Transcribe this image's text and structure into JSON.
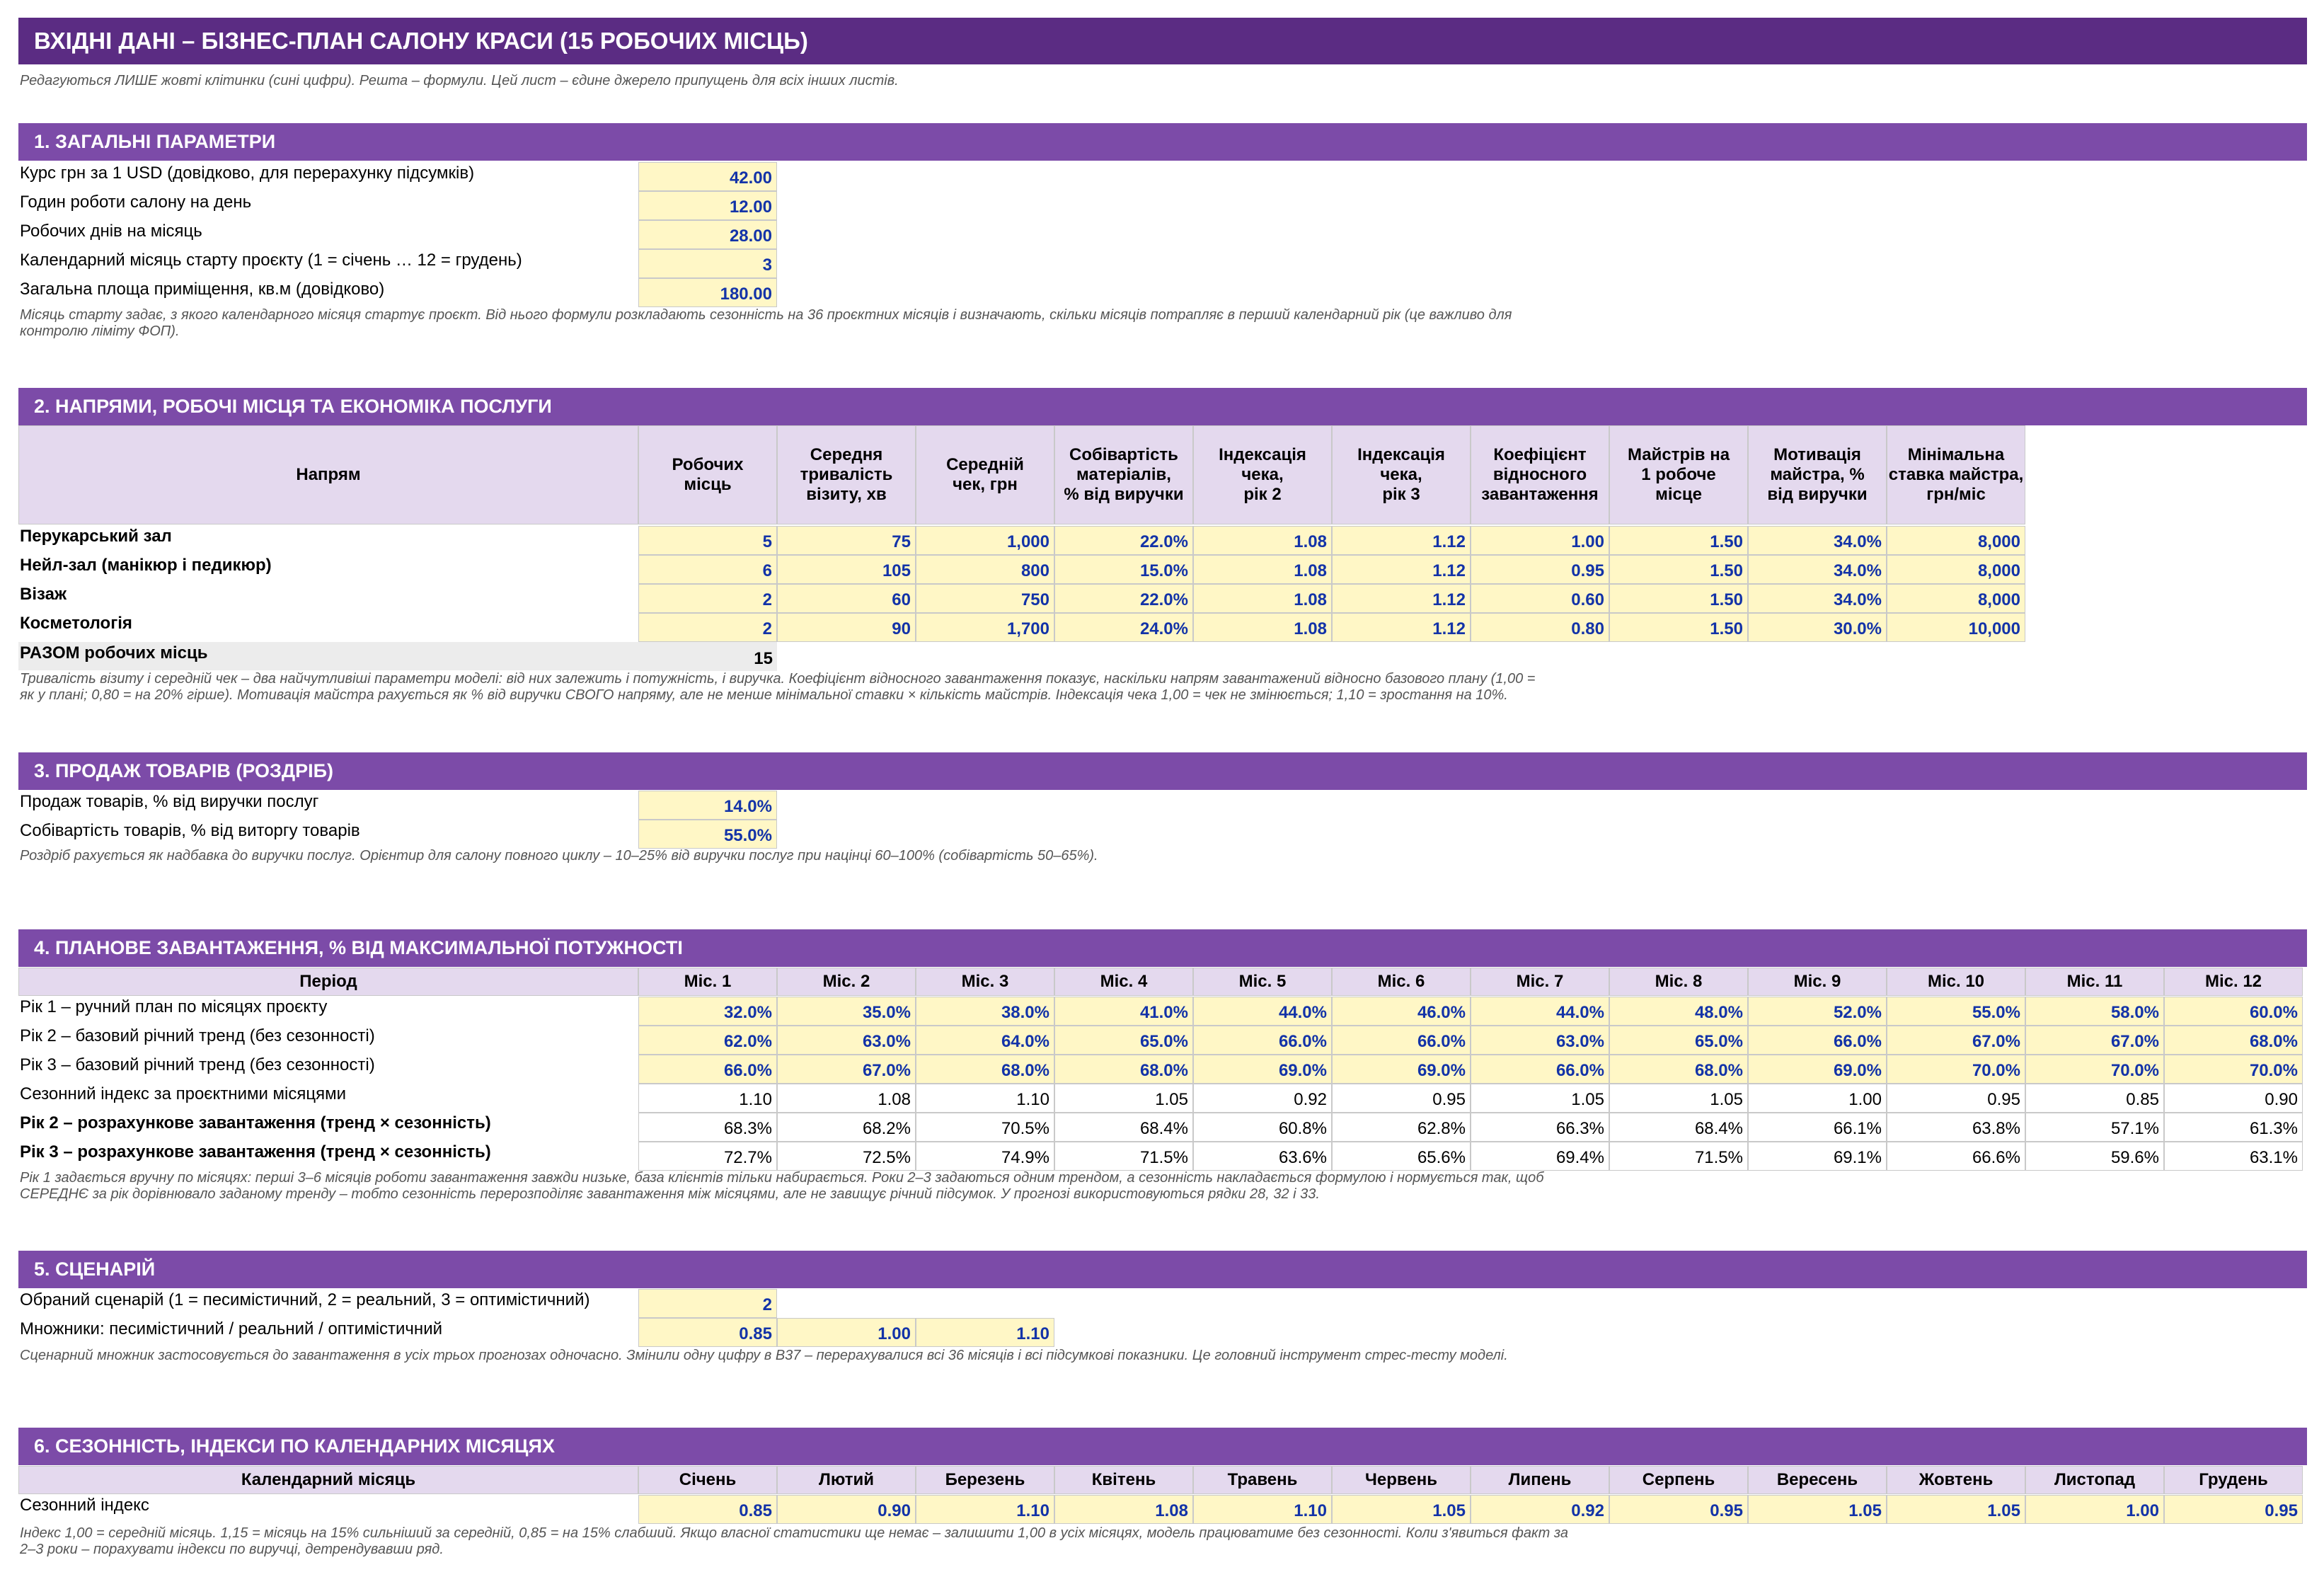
{
  "title": "ВХІДНІ ДАНІ – БІЗНЕС-ПЛАН САЛОНУ КРАСИ (15 РОБОЧИХ МІСЦЬ)",
  "subtitle": "Редагуються ЛИШЕ жовті клітинки (сині цифри). Решта – формули. Цей лист – єдине джерело припущень для всіх інших листів.",
  "s1": {
    "header": "1. ЗАГАЛЬНІ ПАРАМЕТРИ",
    "rows": [
      {
        "label": "Курс грн за 1 USD (довідково, для перерахунку підсумків)",
        "value": "42.00"
      },
      {
        "label": "Годин роботи салону на день",
        "value": "12.00"
      },
      {
        "label": "Робочих днів на місяць",
        "value": "28.00"
      },
      {
        "label": "Календарний місяць старту проєкту (1 = січень … 12 = грудень)",
        "value": "3"
      },
      {
        "label": "Загальна площа приміщення, кв.м (довідково)",
        "value": "180.00"
      }
    ],
    "note1": "Місяць старту задає, з якого календарного місяця стартує проєкт. Від нього формули розкладають сезонність на 36 проєктних місяців і визначають, скільки місяців потрапляє в перший календарний рік (це важливо для",
    "note2": "контролю ліміту ФОП)."
  },
  "s2": {
    "header": "2. НАПРЯМИ, РОБОЧІ МІСЦЯ ТА ЕКОНОМІКА ПОСЛУГИ",
    "col0": "Напрям",
    "cols": [
      [
        "Робочих",
        "місць"
      ],
      [
        "Середня",
        "тривалість",
        "візиту, хв"
      ],
      [
        "Середній",
        "чек, грн"
      ],
      [
        "Собівартість",
        "матеріалів,",
        "% від виручки"
      ],
      [
        "Індексація",
        "чека,",
        "рік 2"
      ],
      [
        "Індексація",
        "чека,",
        "рік 3"
      ],
      [
        "Коефіцієнт",
        "відносного",
        "завантаження"
      ],
      [
        "Майстрів на",
        "1 робоче",
        "місце"
      ],
      [
        "Мотивація",
        "майстра, %",
        "від виручки"
      ],
      [
        "Мінімальна",
        "ставка майстра,",
        "грн/міс"
      ]
    ],
    "rows": [
      {
        "label": "Перукарський зал",
        "v": [
          "5",
          "75",
          "1,000",
          "22.0%",
          "1.08",
          "1.12",
          "1.00",
          "1.50",
          "34.0%",
          "8,000"
        ]
      },
      {
        "label": "Нейл-зал (манікюр і педикюр)",
        "v": [
          "6",
          "105",
          "800",
          "15.0%",
          "1.08",
          "1.12",
          "0.95",
          "1.50",
          "34.0%",
          "8,000"
        ]
      },
      {
        "label": "Візаж",
        "v": [
          "2",
          "60",
          "750",
          "22.0%",
          "1.08",
          "1.12",
          "0.60",
          "1.50",
          "34.0%",
          "8,000"
        ]
      },
      {
        "label": "Косметологія",
        "v": [
          "2",
          "90",
          "1,700",
          "24.0%",
          "1.08",
          "1.12",
          "0.80",
          "1.50",
          "30.0%",
          "10,000"
        ]
      }
    ],
    "total_label": "РАЗОМ робочих місць",
    "total_value": "15",
    "note1": "Тривалість візиту і середній чек – два найчутливіші параметри моделі: від них залежить і потужність, і виручка. Коефіцієнт відносного завантаження показує, наскільки напрям завантажений відносно базового плану (1,00 =",
    "note2": "як у плані; 0,80 = на 20% гірше). Мотивація майстра рахується як % від виручки СВОГО напряму, але не менше мінімальної ставки × кількість майстрів. Індексація чека 1,00 = чек не змінюється; 1,10 = зростання на 10%."
  },
  "s3": {
    "header": "3. ПРОДАЖ ТОВАРІВ (РОЗДРІБ)",
    "rows": [
      {
        "label": "Продаж товарів, % від виручки послуг",
        "value": "14.0%"
      },
      {
        "label": "Собівартість товарів, % від виторгу товарів",
        "value": "55.0%"
      }
    ],
    "note1": "Роздріб рахується як надбавка до виручки послуг. Орієнтир для салону повного циклу – 10–25% від виручки послуг при націнці 60–100% (собівартість 50–65%)."
  },
  "s4": {
    "header": "4. ПЛАНОВЕ ЗАВАНТАЖЕННЯ, % ВІД МАКСИМАЛЬНОЇ ПОТУЖНОСТІ",
    "col0": "Період",
    "months": [
      "Міс. 1",
      "Міс. 2",
      "Міс. 3",
      "Міс. 4",
      "Міс. 5",
      "Міс. 6",
      "Міс. 7",
      "Міс. 8",
      "Міс. 9",
      "Міс. 10",
      "Міс. 11",
      "Міс. 12"
    ],
    "rows": [
      {
        "label": "Рік 1 – ручний план по місяцях проєкту",
        "v": [
          "32.0%",
          "35.0%",
          "38.0%",
          "41.0%",
          "44.0%",
          "46.0%",
          "44.0%",
          "48.0%",
          "52.0%",
          "55.0%",
          "58.0%",
          "60.0%"
        ]
      },
      {
        "label": "Рік 2 – базовий річний тренд (без сезонності)",
        "v": [
          "62.0%",
          "63.0%",
          "64.0%",
          "65.0%",
          "66.0%",
          "66.0%",
          "63.0%",
          "65.0%",
          "66.0%",
          "67.0%",
          "67.0%",
          "68.0%"
        ]
      },
      {
        "label": "Рік 3 – базовий річний тренд (без сезонності)",
        "v": [
          "66.0%",
          "67.0%",
          "68.0%",
          "68.0%",
          "69.0%",
          "69.0%",
          "66.0%",
          "68.0%",
          "69.0%",
          "70.0%",
          "70.0%",
          "70.0%"
        ]
      },
      {
        "label": "Сезонний індекс за проєктними місяцями",
        "v": [
          "1.10",
          "1.08",
          "1.10",
          "1.05",
          "0.92",
          "0.95",
          "1.05",
          "1.05",
          "1.00",
          "0.95",
          "0.85",
          "0.90"
        ]
      },
      {
        "label": "Рік 2 – розрахункове завантаження (тренд × сезонність)",
        "v": [
          "68.3%",
          "68.2%",
          "70.5%",
          "68.4%",
          "60.8%",
          "62.8%",
          "66.3%",
          "68.4%",
          "66.1%",
          "63.8%",
          "57.1%",
          "61.3%"
        ]
      },
      {
        "label": "Рік 3 – розрахункове завантаження (тренд × сезонність)",
        "v": [
          "72.7%",
          "72.5%",
          "74.9%",
          "71.5%",
          "63.6%",
          "65.6%",
          "69.4%",
          "71.5%",
          "69.1%",
          "66.6%",
          "59.6%",
          "63.1%"
        ]
      }
    ],
    "note1": "Рік 1 задається вручну по місяцях: перші 3–6 місяців роботи завантаження завжди низьке, база клієнтів тільки набирається. Роки 2–3 задаються одним трендом, а сезонність накладається формулою і нормується так, щоб",
    "note2": "СЕРЕДНЄ за рік дорівнювало заданому тренду – тобто сезонність перерозподіляє завантаження між місяцями, але не завищує річний підсумок. У прогнозі використовуються рядки 28, 32 і 33."
  },
  "s5": {
    "header": "5. СЦЕНАРІЙ",
    "row1_label": "Обраний сценарій (1 = песимістичний, 2 = реальний, 3 = оптимістичний)",
    "row1_value": "2",
    "row2_label": "Множники: песимістичний / реальний / оптимістичний",
    "row2_values": [
      "0.85",
      "1.00",
      "1.10"
    ],
    "note1": "Сценарний множник застосовується до завантаження в усіх трьох прогнозах одночасно. Змінили одну цифру в B37 – перерахувалися всі 36 місяців і всі підсумкові показники. Це головний інструмент стрес-тесту моделі."
  },
  "s6": {
    "header": "6. СЕЗОННІСТЬ, ІНДЕКСИ ПО КАЛЕНДАРНИХ МІСЯЦЯХ",
    "col0": "Календарний місяць",
    "months": [
      "Січень",
      "Лютий",
      "Березень",
      "Квітень",
      "Травень",
      "Червень",
      "Липень",
      "Серпень",
      "Вересень",
      "Жовтень",
      "Листопад",
      "Грудень"
    ],
    "row_label": "Сезонний індекс",
    "values": [
      "0.85",
      "0.90",
      "1.10",
      "1.08",
      "1.10",
      "1.05",
      "0.92",
      "0.95",
      "1.05",
      "1.05",
      "1.00",
      "0.95"
    ],
    "note1": "Індекс 1,00 = середній місяць. 1,15 = місяць на 15% сильніший за середній, 0,85 = на 15% слабший. Якщо власної статистики ще немає – залишити 1,00 в усіх місяцях, модель працюватиме без сезонності. Коли з'явиться факт за",
    "note2": "2–3 роки – порахувати індекси по виручці, детрендувавши ряд."
  }
}
